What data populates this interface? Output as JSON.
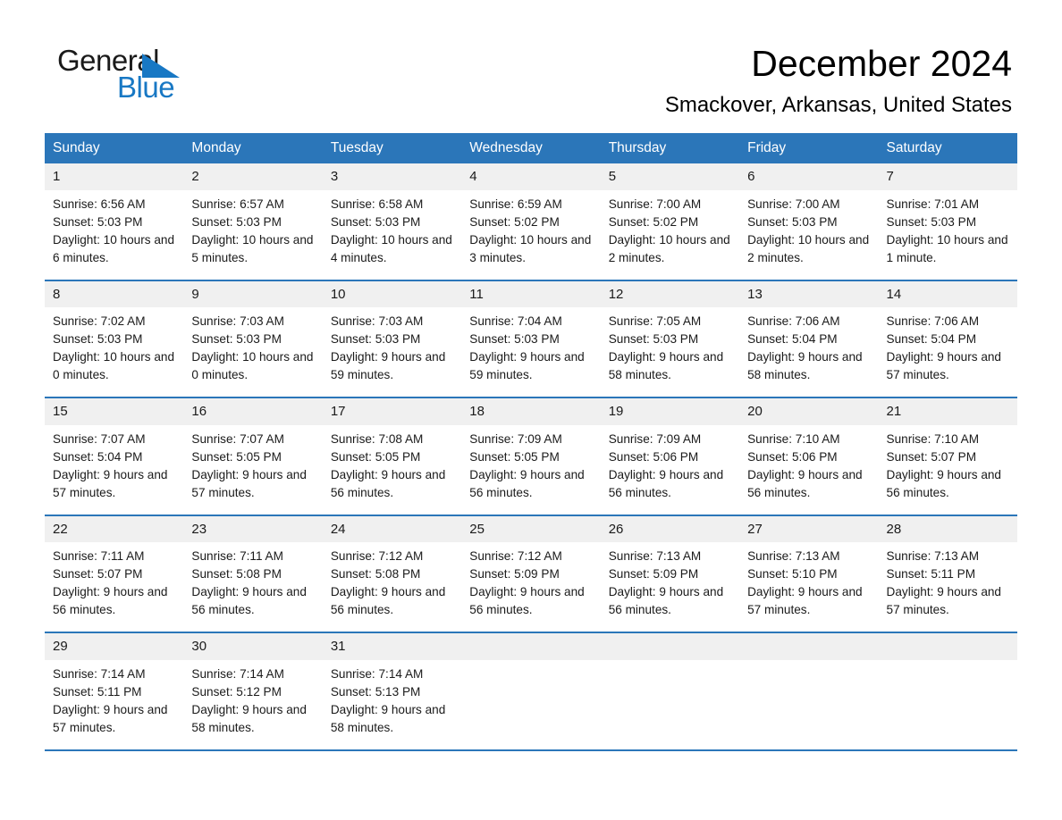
{
  "logo": {
    "word_one": "General",
    "word_two": "Blue",
    "triangle": "blue-triangle-icon"
  },
  "header": {
    "title": "December 2024",
    "subtitle": "Smackover, Arkansas, United States"
  },
  "colors": {
    "header_blue": "#2b76b9",
    "daynum_band": "#f0f0f0",
    "logo_blue": "#1878c4",
    "text": "#1a1a1a"
  },
  "weekdays": [
    "Sunday",
    "Monday",
    "Tuesday",
    "Wednesday",
    "Thursday",
    "Friday",
    "Saturday"
  ],
  "weeks": [
    [
      {
        "day": "1",
        "sunrise": "Sunrise: 6:56 AM",
        "sunset": "Sunset: 5:03 PM",
        "daylight": "Daylight: 10 hours and 6 minutes."
      },
      {
        "day": "2",
        "sunrise": "Sunrise: 6:57 AM",
        "sunset": "Sunset: 5:03 PM",
        "daylight": "Daylight: 10 hours and 5 minutes."
      },
      {
        "day": "3",
        "sunrise": "Sunrise: 6:58 AM",
        "sunset": "Sunset: 5:03 PM",
        "daylight": "Daylight: 10 hours and 4 minutes."
      },
      {
        "day": "4",
        "sunrise": "Sunrise: 6:59 AM",
        "sunset": "Sunset: 5:02 PM",
        "daylight": "Daylight: 10 hours and 3 minutes."
      },
      {
        "day": "5",
        "sunrise": "Sunrise: 7:00 AM",
        "sunset": "Sunset: 5:02 PM",
        "daylight": "Daylight: 10 hours and 2 minutes."
      },
      {
        "day": "6",
        "sunrise": "Sunrise: 7:00 AM",
        "sunset": "Sunset: 5:03 PM",
        "daylight": "Daylight: 10 hours and 2 minutes."
      },
      {
        "day": "7",
        "sunrise": "Sunrise: 7:01 AM",
        "sunset": "Sunset: 5:03 PM",
        "daylight": "Daylight: 10 hours and 1 minute."
      }
    ],
    [
      {
        "day": "8",
        "sunrise": "Sunrise: 7:02 AM",
        "sunset": "Sunset: 5:03 PM",
        "daylight": "Daylight: 10 hours and 0 minutes."
      },
      {
        "day": "9",
        "sunrise": "Sunrise: 7:03 AM",
        "sunset": "Sunset: 5:03 PM",
        "daylight": "Daylight: 10 hours and 0 minutes."
      },
      {
        "day": "10",
        "sunrise": "Sunrise: 7:03 AM",
        "sunset": "Sunset: 5:03 PM",
        "daylight": "Daylight: 9 hours and 59 minutes."
      },
      {
        "day": "11",
        "sunrise": "Sunrise: 7:04 AM",
        "sunset": "Sunset: 5:03 PM",
        "daylight": "Daylight: 9 hours and 59 minutes."
      },
      {
        "day": "12",
        "sunrise": "Sunrise: 7:05 AM",
        "sunset": "Sunset: 5:03 PM",
        "daylight": "Daylight: 9 hours and 58 minutes."
      },
      {
        "day": "13",
        "sunrise": "Sunrise: 7:06 AM",
        "sunset": "Sunset: 5:04 PM",
        "daylight": "Daylight: 9 hours and 58 minutes."
      },
      {
        "day": "14",
        "sunrise": "Sunrise: 7:06 AM",
        "sunset": "Sunset: 5:04 PM",
        "daylight": "Daylight: 9 hours and 57 minutes."
      }
    ],
    [
      {
        "day": "15",
        "sunrise": "Sunrise: 7:07 AM",
        "sunset": "Sunset: 5:04 PM",
        "daylight": "Daylight: 9 hours and 57 minutes."
      },
      {
        "day": "16",
        "sunrise": "Sunrise: 7:07 AM",
        "sunset": "Sunset: 5:05 PM",
        "daylight": "Daylight: 9 hours and 57 minutes."
      },
      {
        "day": "17",
        "sunrise": "Sunrise: 7:08 AM",
        "sunset": "Sunset: 5:05 PM",
        "daylight": "Daylight: 9 hours and 56 minutes."
      },
      {
        "day": "18",
        "sunrise": "Sunrise: 7:09 AM",
        "sunset": "Sunset: 5:05 PM",
        "daylight": "Daylight: 9 hours and 56 minutes."
      },
      {
        "day": "19",
        "sunrise": "Sunrise: 7:09 AM",
        "sunset": "Sunset: 5:06 PM",
        "daylight": "Daylight: 9 hours and 56 minutes."
      },
      {
        "day": "20",
        "sunrise": "Sunrise: 7:10 AM",
        "sunset": "Sunset: 5:06 PM",
        "daylight": "Daylight: 9 hours and 56 minutes."
      },
      {
        "day": "21",
        "sunrise": "Sunrise: 7:10 AM",
        "sunset": "Sunset: 5:07 PM",
        "daylight": "Daylight: 9 hours and 56 minutes."
      }
    ],
    [
      {
        "day": "22",
        "sunrise": "Sunrise: 7:11 AM",
        "sunset": "Sunset: 5:07 PM",
        "daylight": "Daylight: 9 hours and 56 minutes."
      },
      {
        "day": "23",
        "sunrise": "Sunrise: 7:11 AM",
        "sunset": "Sunset: 5:08 PM",
        "daylight": "Daylight: 9 hours and 56 minutes."
      },
      {
        "day": "24",
        "sunrise": "Sunrise: 7:12 AM",
        "sunset": "Sunset: 5:08 PM",
        "daylight": "Daylight: 9 hours and 56 minutes."
      },
      {
        "day": "25",
        "sunrise": "Sunrise: 7:12 AM",
        "sunset": "Sunset: 5:09 PM",
        "daylight": "Daylight: 9 hours and 56 minutes."
      },
      {
        "day": "26",
        "sunrise": "Sunrise: 7:13 AM",
        "sunset": "Sunset: 5:09 PM",
        "daylight": "Daylight: 9 hours and 56 minutes."
      },
      {
        "day": "27",
        "sunrise": "Sunrise: 7:13 AM",
        "sunset": "Sunset: 5:10 PM",
        "daylight": "Daylight: 9 hours and 57 minutes."
      },
      {
        "day": "28",
        "sunrise": "Sunrise: 7:13 AM",
        "sunset": "Sunset: 5:11 PM",
        "daylight": "Daylight: 9 hours and 57 minutes."
      }
    ],
    [
      {
        "day": "29",
        "sunrise": "Sunrise: 7:14 AM",
        "sunset": "Sunset: 5:11 PM",
        "daylight": "Daylight: 9 hours and 57 minutes."
      },
      {
        "day": "30",
        "sunrise": "Sunrise: 7:14 AM",
        "sunset": "Sunset: 5:12 PM",
        "daylight": "Daylight: 9 hours and 58 minutes."
      },
      {
        "day": "31",
        "sunrise": "Sunrise: 7:14 AM",
        "sunset": "Sunset: 5:13 PM",
        "daylight": "Daylight: 9 hours and 58 minutes."
      },
      {
        "day": "",
        "sunrise": "",
        "sunset": "",
        "daylight": ""
      },
      {
        "day": "",
        "sunrise": "",
        "sunset": "",
        "daylight": ""
      },
      {
        "day": "",
        "sunrise": "",
        "sunset": "",
        "daylight": ""
      },
      {
        "day": "",
        "sunrise": "",
        "sunset": "",
        "daylight": ""
      }
    ]
  ]
}
